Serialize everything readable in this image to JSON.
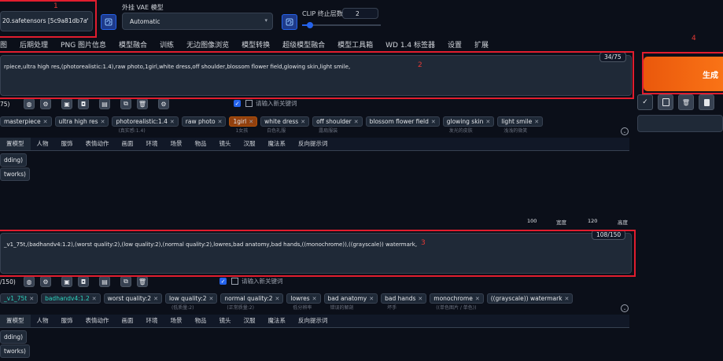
{
  "markers": [
    "1",
    "2",
    "3",
    "4"
  ],
  "checkpoint": {
    "label": "",
    "value": "20.safetensors [5c9a81db7a'"
  },
  "vae": {
    "label": "外挂 VAE 模型",
    "value": "Automatic"
  },
  "clip": {
    "label": "CLIP 终止层数",
    "value": "2"
  },
  "tabs": [
    "图",
    "后期处理",
    "PNG 图片信息",
    "模型融合",
    "训练",
    "无边图像浏览",
    "模型转换",
    "超级模型融合",
    "模型工具箱",
    "WD 1.4 标签器",
    "设置",
    "扩展"
  ],
  "positive": {
    "text": "rpiece,ultra high res,(photorealistic:1.4),raw photo,1girl,white dress,off shoulder,blossom flower field,glowing skin,light smile,",
    "counter": "34/75",
    "count_label": "75)",
    "keyword_placeholder": "请输入新关键词",
    "tags": [
      {
        "text": "masterpiece",
        "sub": "",
        "highlight": false
      },
      {
        "text": "ultra high res",
        "sub": "",
        "highlight": false
      },
      {
        "text": "photorealistic:1.4",
        "sub": "(真实感:1.4)",
        "highlight": false
      },
      {
        "text": "raw photo",
        "sub": "",
        "highlight": false
      },
      {
        "text": "1girl",
        "sub": "1女孩",
        "highlight": true
      },
      {
        "text": "white dress",
        "sub": "白色礼服",
        "highlight": false
      },
      {
        "text": "off shoulder",
        "sub": "露肩服装",
        "highlight": false
      },
      {
        "text": "blossom flower field",
        "sub": "",
        "highlight": false
      },
      {
        "text": "glowing skin",
        "sub": "发光的皮肤",
        "highlight": false
      },
      {
        "text": "light smile",
        "sub": "浅浅的微笑",
        "highlight": false
      }
    ]
  },
  "categories": [
    "置模型",
    "人物",
    "服饰",
    "表情动作",
    "画面",
    "环境",
    "场景",
    "物品",
    "镜头",
    "汉服",
    "魔法系",
    "反向提示词"
  ],
  "side_buttons": [
    "dding)",
    "tworks)"
  ],
  "dims": {
    "width_value": "100",
    "width_label": "宽度",
    "height_value": "120",
    "height_label": "高度"
  },
  "negative": {
    "text": "_v1_75t,(badhandv4:1.2),(worst quality:2),(low quality:2),(normal quality:2),lowres,bad anatomy,bad hands,((monochrome)),((grayscale)) watermark,",
    "counter": "108/150",
    "count_label": "/150)",
    "keyword_placeholder": "请输入新关键词",
    "tags": [
      {
        "text": "_v1_75t",
        "sub": "",
        "teal": true
      },
      {
        "text": "badhandv4:1.2",
        "sub": "",
        "teal": true
      },
      {
        "text": "worst quality:2",
        "sub": "",
        "teal": false
      },
      {
        "text": "low quality:2",
        "sub": "(低质量:2)",
        "teal": false
      },
      {
        "text": "normal quality:2",
        "sub": "(正常质量:2)",
        "teal": false
      },
      {
        "text": "lowres",
        "sub": "低分辨率",
        "teal": false
      },
      {
        "text": "bad anatomy",
        "sub": "错误的解剖",
        "teal": false
      },
      {
        "text": "bad hands",
        "sub": "坏手",
        "teal": false
      },
      {
        "text": "monochrome",
        "sub": "((单色图片 / 单色))",
        "teal": false
      },
      {
        "text": "((grayscale)) watermark",
        "sub": "",
        "teal": false
      }
    ]
  },
  "generate": {
    "label": "生成"
  },
  "colors": {
    "accent": "#ea580c",
    "red": "#e11d2e",
    "bg": "#0b0f19",
    "panel": "#1f2937",
    "teal": "#2dd4bf"
  }
}
